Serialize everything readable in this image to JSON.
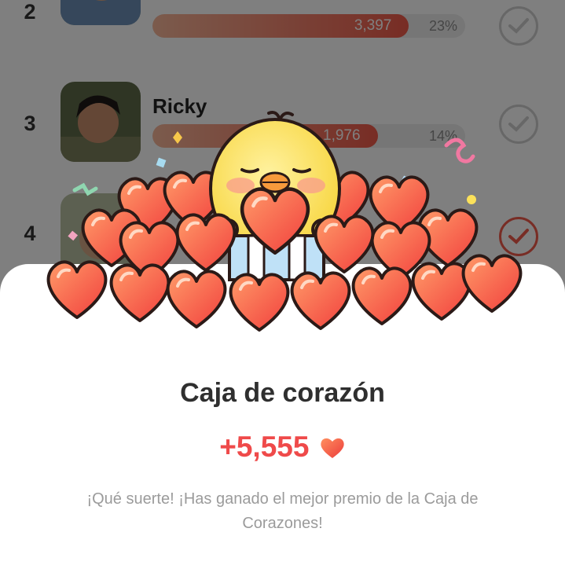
{
  "ranking": [
    {
      "rank": "2",
      "name": "",
      "votes": "3,397",
      "percent": "23%",
      "fill": 0.82,
      "checked": false
    },
    {
      "rank": "3",
      "name": "Ricky",
      "votes": "1,976",
      "percent": "14%",
      "fill": 0.72,
      "checked": false
    },
    {
      "rank": "4",
      "name": "",
      "votes": "",
      "percent": "",
      "fill": 0.0,
      "checked": true
    }
  ],
  "modal": {
    "title": "Caja de corazón",
    "reward": "+5,555",
    "message": "¡Qué suerte! ¡Has ganado el mejor premio de la Caja de Corazones!",
    "reward_icon": "heart-icon"
  },
  "colors": {
    "accent": "#ef4a4a",
    "heart_light": "#ff8a5c",
    "heart_dark": "#f0433f",
    "chick": "#fde25c"
  }
}
